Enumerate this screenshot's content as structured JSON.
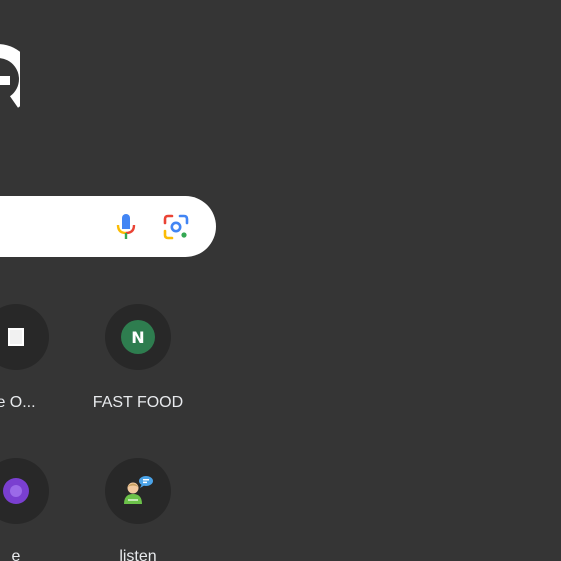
{
  "shortcuts": [
    {
      "label": "e O...",
      "icon": "page-icon"
    },
    {
      "label": "FAST FOOD",
      "letter": "N",
      "badge_color": "#2e7d4f",
      "icon": "letter-avatar-icon"
    },
    {
      "label": "e",
      "icon": "purple-circle-icon",
      "icon_color": "#7a3fd0"
    },
    {
      "label": "listen",
      "icon": "chat-user-icon"
    }
  ],
  "search": {
    "mic_icon": "microphone-icon",
    "lens_icon": "google-lens-icon"
  },
  "colors": {
    "background": "#353535",
    "tile": "#282828",
    "label": "#e8eaed",
    "search_bg": "#ffffff"
  }
}
